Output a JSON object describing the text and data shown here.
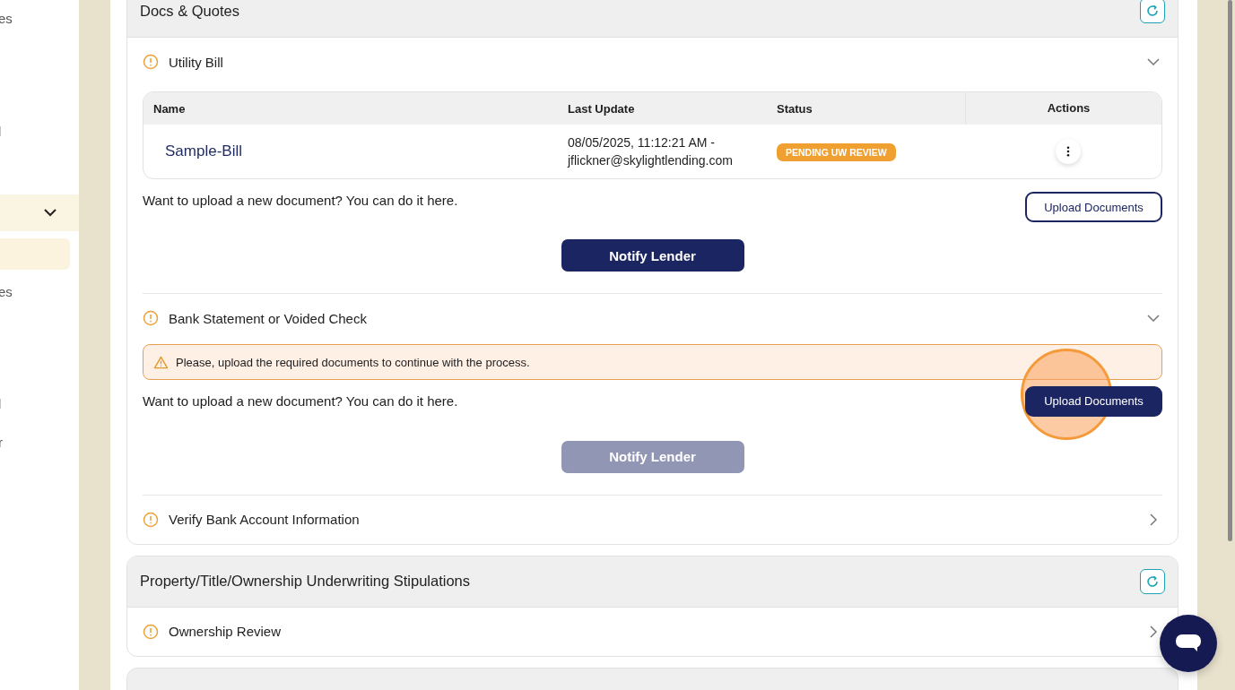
{
  "sidebar": {
    "items": [
      {
        "label": "es",
        "kind": "link"
      },
      {
        "label": "l",
        "kind": "link"
      },
      {
        "kind": "group",
        "expanded": true
      },
      {
        "kind": "sub",
        "selected": true
      },
      {
        "label": "es",
        "kind": "link"
      },
      {
        "label": "l",
        "kind": "link"
      },
      {
        "label": "r",
        "kind": "link"
      }
    ]
  },
  "sections": [
    {
      "title": "Docs & Quotes",
      "items": [
        {
          "title": "Utility Bill",
          "expanded": true,
          "table": {
            "columns": [
              "Name",
              "Last Update",
              "Status",
              "Actions"
            ],
            "rows": [
              {
                "name": "Sample-Bill",
                "last_update": "08/05/2025, 11:12:21 AM - jflickner@skylightlending.com",
                "status": "PENDING UW REVIEW"
              }
            ]
          },
          "prompt": "Want to upload a new document? You can do it here.",
          "upload_button": {
            "label": "Upload Documents",
            "kind": "outline"
          },
          "notify_button": {
            "label": "Notify Lender",
            "disabled": false
          }
        },
        {
          "title": "Bank Statement or Voided Check",
          "expanded": true,
          "alert": "Please, upload the required documents to continue with the process.",
          "prompt": "Want to upload a new document? You can do it here.",
          "upload_button": {
            "label": "Upload Documents",
            "kind": "filled",
            "click_highlight": true
          },
          "notify_button": {
            "label": "Notify Lender",
            "disabled": true
          }
        },
        {
          "title": "Verify Bank Account Information",
          "expanded": false
        }
      ]
    },
    {
      "title": "Property/Title/Ownership Underwriting Stipulations",
      "items": [
        {
          "title": "Ownership Review",
          "expanded": false
        }
      ]
    }
  ]
}
